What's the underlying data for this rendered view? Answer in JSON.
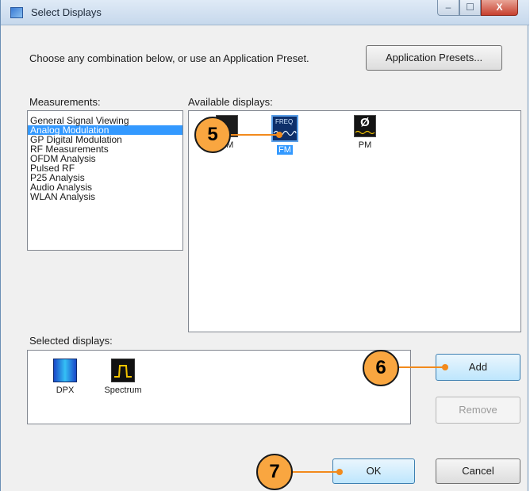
{
  "window": {
    "title": "Select Displays",
    "controls": {
      "minimize": "–",
      "maximize": "☐",
      "close": "X"
    }
  },
  "instructions": "Choose any combination below, or use an Application Preset.",
  "buttons": {
    "application_presets": "Application Presets...",
    "add": "Add",
    "remove": "Remove",
    "ok": "OK",
    "cancel": "Cancel"
  },
  "measurements": {
    "label": "Measurements:",
    "selected": "Analog Modulation",
    "items": [
      "General Signal Viewing",
      "Analog Modulation",
      "GP Digital Modulation",
      "RF Measurements",
      "OFDM Analysis",
      "Pulsed RF",
      "P25 Analysis",
      "Audio Analysis",
      "WLAN Analysis"
    ]
  },
  "available": {
    "label": "Available displays:",
    "items": [
      {
        "label": "AM",
        "icon": "am-display-icon"
      },
      {
        "label": "FM",
        "icon": "fm-display-icon",
        "icon_text": "FREQ",
        "selected": true
      },
      {
        "label": "PM",
        "icon": "pm-display-icon",
        "icon_text": "Ø"
      }
    ]
  },
  "selected_displays": {
    "label": "Selected displays:",
    "items": [
      {
        "label": "DPX",
        "icon": "dpx-display-icon"
      },
      {
        "label": "Spectrum",
        "icon": "spectrum-display-icon"
      }
    ]
  },
  "callouts": [
    "5",
    "6",
    "7"
  ],
  "colors": {
    "callout_fill": "#f9a640",
    "callout_line": "#f28a1c",
    "selection": "#3399ff"
  }
}
